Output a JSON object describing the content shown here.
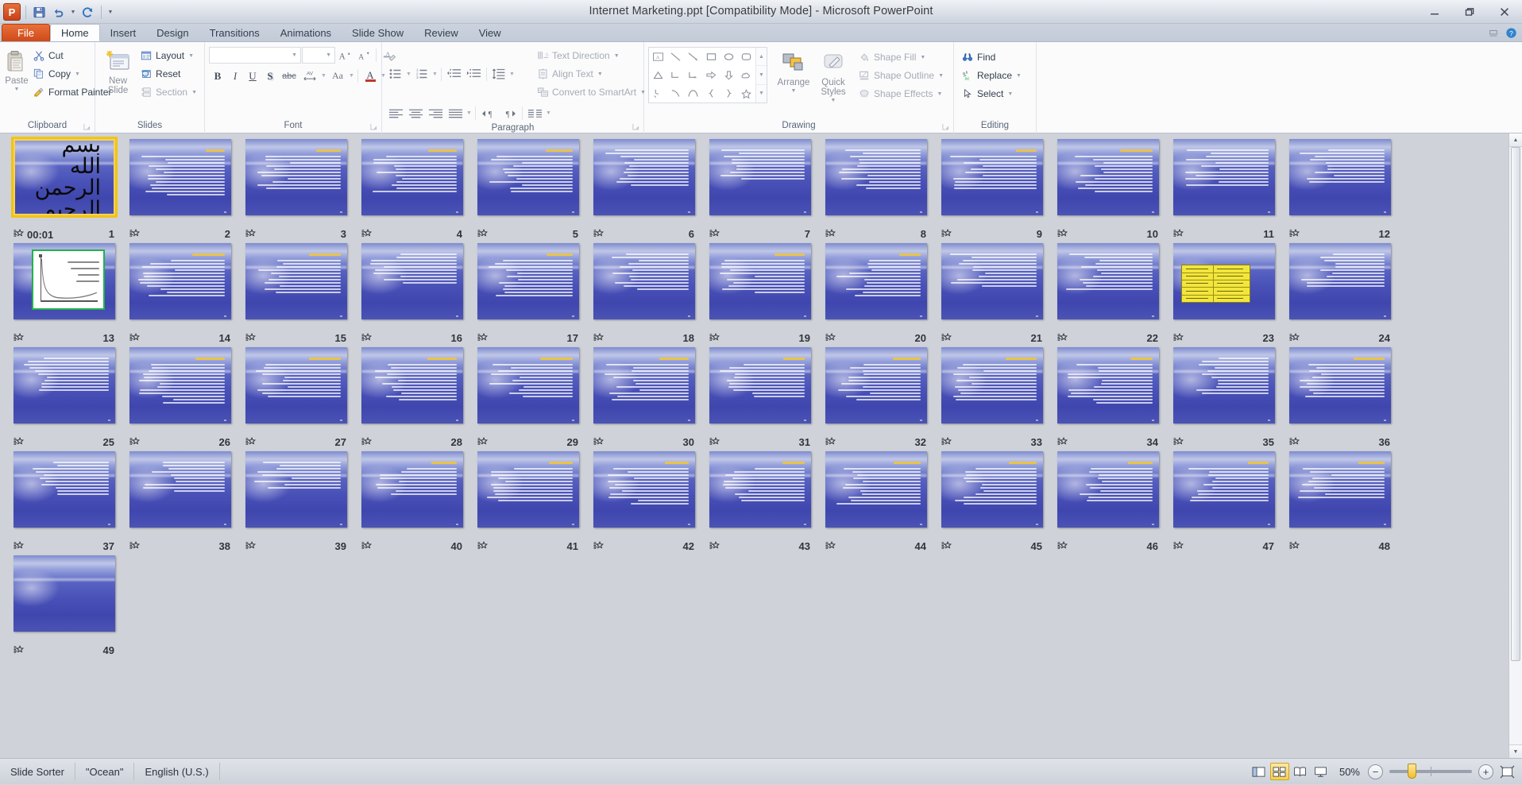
{
  "window": {
    "title": "Internet Marketing.ppt [Compatibility Mode]  -  Microsoft PowerPoint",
    "app_icon": "P",
    "minimize_label": "Minimize",
    "restore_label": "Restore Down",
    "close_label": "Close"
  },
  "quick_access": [
    {
      "name": "save-button",
      "icon": "save-icon"
    },
    {
      "name": "undo-button",
      "icon": "undo-icon"
    },
    {
      "name": "redo-button",
      "icon": "redo-icon"
    },
    {
      "name": "customize-qat-button",
      "icon": "chevron-down-icon"
    }
  ],
  "tabs": [
    {
      "label": "File",
      "id": "file"
    },
    {
      "label": "Home",
      "id": "home"
    },
    {
      "label": "Insert",
      "id": "insert"
    },
    {
      "label": "Design",
      "id": "design"
    },
    {
      "label": "Transitions",
      "id": "transitions"
    },
    {
      "label": "Animations",
      "id": "animations"
    },
    {
      "label": "Slide Show",
      "id": "slide-show"
    },
    {
      "label": "Review",
      "id": "review"
    },
    {
      "label": "View",
      "id": "view"
    }
  ],
  "active_tab": "Home",
  "ribbon": {
    "clipboard": {
      "label": "Clipboard",
      "paste": "Paste",
      "cut": "Cut",
      "copy": "Copy",
      "format_painter": "Format Painter"
    },
    "slides": {
      "label": "Slides",
      "new_slide": "New",
      "new_slide_2": "Slide",
      "layout": "Layout",
      "reset": "Reset",
      "section": "Section"
    },
    "font": {
      "label": "Font",
      "font_name_value": "",
      "font_size_value": "",
      "grow": "A",
      "shrink": "A",
      "clear_formatting": "Clear All Formatting",
      "bold": "B",
      "italic": "I",
      "underline": "U",
      "shadow": "S",
      "strikethrough": "abc",
      "character_spacing": "AV",
      "change_case": "Aa",
      "font_color": "A"
    },
    "paragraph": {
      "label": "Paragraph",
      "bullets": "Bullets",
      "numbering": "Numbering",
      "decrease_indent": "Decrease List Level",
      "increase_indent": "Increase List Level",
      "line_spacing": "Line Spacing",
      "align_left": "Align Text Left",
      "align_center": "Center",
      "align_right": "Align Text Right",
      "justify": "Justify",
      "ltr": "Left-to-Right",
      "rtl": "Right-to-Left",
      "columns": "Columns",
      "text_direction": "Text Direction",
      "align_text": "Align Text",
      "convert_to_smartart": "Convert to SmartArt"
    },
    "drawing": {
      "label": "Drawing",
      "arrange": "Arrange",
      "quick_styles": "Quick",
      "quick_styles_2": "Styles",
      "shape_fill": "Shape Fill",
      "shape_outline": "Shape Outline",
      "shape_effects": "Shape Effects",
      "shapes": [
        "textbox-shape",
        "line-shape",
        "arrow-shape",
        "rectangle-shape",
        "oval-shape",
        "rounded-rectangle-shape",
        "triangle-shape",
        "elbow-connector-shape",
        "elbow-arrow-connector-shape",
        "right-arrow-shape",
        "down-arrow-shape",
        "cloud-shape",
        "freeform-shape",
        "curve-shape",
        "arc-shape",
        "left-brace-shape",
        "right-brace-shape",
        "star-shape"
      ]
    },
    "editing": {
      "label": "Editing",
      "find": "Find",
      "replace": "Replace",
      "select": "Select"
    }
  },
  "status_bar": {
    "view_name": "Slide Sorter",
    "theme": "\"Ocean\"",
    "language": "English (U.S.)",
    "zoom_level": "50%",
    "view_buttons": [
      {
        "name": "normal-view-button",
        "label": "Normal"
      },
      {
        "name": "slide-sorter-view-button",
        "label": "Slide Sorter"
      },
      {
        "name": "reading-view-button",
        "label": "Reading View"
      },
      {
        "name": "slide-show-view-button",
        "label": "Slide Show"
      }
    ],
    "zoom_out_label": "−",
    "zoom_in_label": "+",
    "fit_window_label": "Fit slide to current window"
  },
  "sorter": {
    "selected_slide": 1,
    "total_slides": 49,
    "slide_1_timing": "00:01",
    "slides": [
      {
        "n": 1,
        "kind": "title",
        "lines": 0,
        "timing": "00:01"
      },
      {
        "n": 2,
        "kind": "text",
        "lines": 13,
        "title": true
      },
      {
        "n": 3,
        "kind": "text",
        "lines": 11,
        "title": true
      },
      {
        "n": 4,
        "kind": "text",
        "lines": 12,
        "title": true
      },
      {
        "n": 5,
        "kind": "text",
        "lines": 12,
        "title": true
      },
      {
        "n": 6,
        "kind": "text",
        "lines": 12,
        "title": false
      },
      {
        "n": 7,
        "kind": "text",
        "lines": 10,
        "title": false
      },
      {
        "n": 8,
        "kind": "text",
        "lines": 13,
        "title": false
      },
      {
        "n": 9,
        "kind": "text",
        "lines": 11,
        "title": true
      },
      {
        "n": 10,
        "kind": "text",
        "lines": 12,
        "title": true
      },
      {
        "n": 11,
        "kind": "text",
        "lines": 12,
        "title": false
      },
      {
        "n": 12,
        "kind": "text",
        "lines": 11,
        "title": false
      },
      {
        "n": 13,
        "kind": "chart",
        "lines": 0,
        "title": false
      },
      {
        "n": 14,
        "kind": "text",
        "lines": 12,
        "title": true
      },
      {
        "n": 15,
        "kind": "text",
        "lines": 11,
        "title": true
      },
      {
        "n": 16,
        "kind": "text",
        "lines": 10,
        "title": false
      },
      {
        "n": 17,
        "kind": "text",
        "lines": 12,
        "title": true
      },
      {
        "n": 18,
        "kind": "text",
        "lines": 12,
        "title": false
      },
      {
        "n": 19,
        "kind": "text",
        "lines": 11,
        "title": true
      },
      {
        "n": 20,
        "kind": "text",
        "lines": 12,
        "title": true
      },
      {
        "n": 21,
        "kind": "text",
        "lines": 11,
        "title": false
      },
      {
        "n": 22,
        "kind": "text",
        "lines": 12,
        "title": false
      },
      {
        "n": 23,
        "kind": "table",
        "lines": 0,
        "title": false
      },
      {
        "n": 24,
        "kind": "text",
        "lines": 11,
        "title": false
      },
      {
        "n": 25,
        "kind": "text",
        "lines": 11,
        "title": false
      },
      {
        "n": 26,
        "kind": "text",
        "lines": 13,
        "title": true
      },
      {
        "n": 27,
        "kind": "text",
        "lines": 11,
        "title": true
      },
      {
        "n": 28,
        "kind": "text",
        "lines": 12,
        "title": true
      },
      {
        "n": 29,
        "kind": "text",
        "lines": 11,
        "title": true
      },
      {
        "n": 30,
        "kind": "text",
        "lines": 12,
        "title": true
      },
      {
        "n": 31,
        "kind": "text",
        "lines": 11,
        "title": true
      },
      {
        "n": 32,
        "kind": "text",
        "lines": 12,
        "title": true
      },
      {
        "n": 33,
        "kind": "text",
        "lines": 12,
        "title": true
      },
      {
        "n": 34,
        "kind": "text",
        "lines": 13,
        "title": true
      },
      {
        "n": 35,
        "kind": "text",
        "lines": 12,
        "title": false
      },
      {
        "n": 36,
        "kind": "text",
        "lines": 11,
        "title": true
      },
      {
        "n": 37,
        "kind": "text",
        "lines": 11,
        "title": false
      },
      {
        "n": 38,
        "kind": "text",
        "lines": 10,
        "title": false
      },
      {
        "n": 39,
        "kind": "text",
        "lines": 9,
        "title": false
      },
      {
        "n": 40,
        "kind": "text",
        "lines": 9,
        "title": true
      },
      {
        "n": 41,
        "kind": "text",
        "lines": 11,
        "title": true
      },
      {
        "n": 42,
        "kind": "text",
        "lines": 12,
        "title": true
      },
      {
        "n": 43,
        "kind": "text",
        "lines": 11,
        "title": true
      },
      {
        "n": 44,
        "kind": "text",
        "lines": 12,
        "title": true
      },
      {
        "n": 45,
        "kind": "text",
        "lines": 12,
        "title": true
      },
      {
        "n": 46,
        "kind": "text",
        "lines": 11,
        "title": true
      },
      {
        "n": 47,
        "kind": "text",
        "lines": 11,
        "title": true
      },
      {
        "n": 48,
        "kind": "text",
        "lines": 10,
        "title": true
      },
      {
        "n": 49,
        "kind": "blank",
        "lines": 0,
        "title": false
      }
    ],
    "basmala_text": "بسم الله الرحمن الرحیم"
  },
  "colors": {
    "accent_orange": "#d3571d",
    "selection_gold": "#f0c419",
    "slide_blue": "#4a52b8",
    "chart_green": "#22b14c",
    "table_yellow": "#f2e63c",
    "status_bg": "#d5dae1"
  }
}
